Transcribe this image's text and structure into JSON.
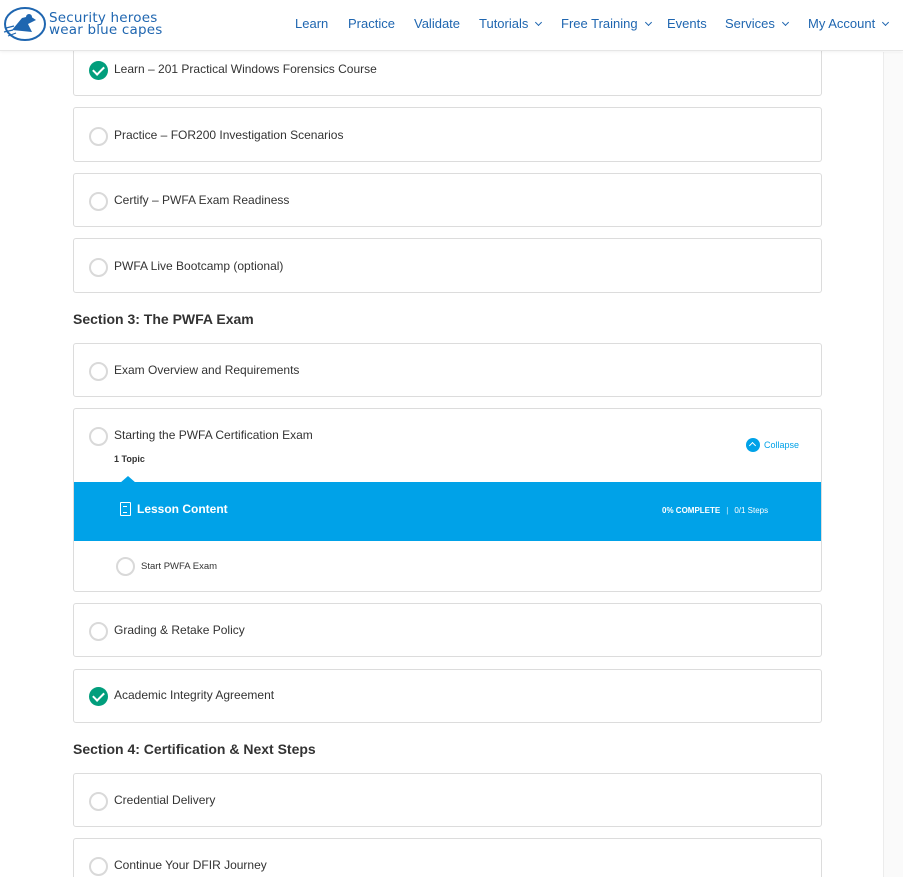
{
  "brand": {
    "line1": "Security heroes",
    "line2": "wear blue capes"
  },
  "nav": [
    {
      "label": "Learn",
      "dropdown": false
    },
    {
      "label": "Practice",
      "dropdown": false
    },
    {
      "label": "Validate",
      "dropdown": false
    },
    {
      "label": "Tutorials",
      "dropdown": true
    },
    {
      "label": "Free Training",
      "dropdown": true
    },
    {
      "label": "Events",
      "dropdown": false
    },
    {
      "label": "Services",
      "dropdown": true
    },
    {
      "label": "My Account",
      "dropdown": true
    }
  ],
  "colors": {
    "brand": "#1f66b0",
    "accent": "#00a2e8",
    "complete": "#019e7c"
  },
  "lessons_top": [
    {
      "label": "Learn – 201 Practical Windows Forensics Course",
      "complete": true
    },
    {
      "label": "Practice – FOR200 Investigation Scenarios",
      "complete": false
    },
    {
      "label": "Certify – PWFA Exam Readiness",
      "complete": false
    },
    {
      "label": "PWFA Live Bootcamp (optional)",
      "complete": false
    }
  ],
  "section3": {
    "title": "Section 3: The PWFA Exam",
    "lessons": [
      {
        "label": "Exam Overview and Requirements",
        "complete": false
      }
    ],
    "expanded_lesson": {
      "label": "Starting the PWFA Certification Exam",
      "complete": false,
      "topic_count": "1 Topic",
      "collapse_label": "Collapse",
      "lesson_content_label": "Lesson Content",
      "progress_text": "0% COMPLETE",
      "steps_text": "0/1 Steps",
      "topics": [
        {
          "label": "Start PWFA Exam",
          "complete": false
        }
      ]
    },
    "lessons_after": [
      {
        "label": "Grading & Retake Policy",
        "complete": false
      },
      {
        "label": "Academic Integrity Agreement",
        "complete": true
      }
    ]
  },
  "section4": {
    "title": "Section 4: Certification & Next Steps",
    "lessons": [
      {
        "label": "Credential Delivery",
        "complete": false
      },
      {
        "label": "Continue Your DFIR Journey",
        "complete": false
      }
    ]
  }
}
